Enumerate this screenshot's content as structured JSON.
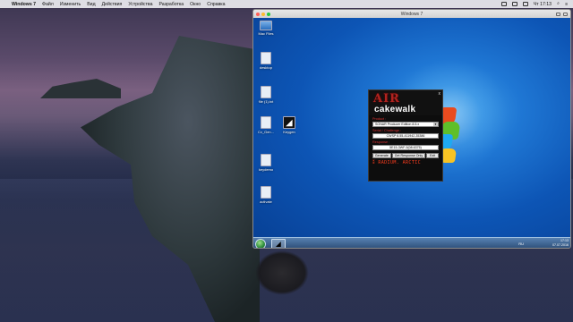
{
  "menubar": {
    "apple": "",
    "app_name": "Windows 7",
    "items": [
      "Файл",
      "Изменить",
      "Вид",
      "Действия",
      "Устройства",
      "Разработка",
      "Окно",
      "Справка"
    ],
    "clock": "Чт 17:13"
  },
  "vm": {
    "title": "Windows 7"
  },
  "desktop_icons": [
    {
      "label": "Mac Files",
      "kind": "pc"
    },
    {
      "label": "desktop",
      "kind": "file"
    },
    {
      "label": "file (1).txt",
      "kind": "file"
    },
    {
      "label": "Cv_Gen...",
      "kind": "file"
    },
    {
      "label": "Keygen",
      "kind": "app"
    },
    {
      "label": "keydemo",
      "kind": "file"
    },
    {
      "label": "activate",
      "kind": "file"
    }
  ],
  "keygen": {
    "logo": "AIR",
    "brand": "cakewalk",
    "close": "x",
    "product_label": "Product :",
    "product_value": "SONAR Producer Edition 8.5.x",
    "serial_label": "Serial / Challenge :",
    "serial_value": "CWSP 8.55-411942-35386",
    "response_label": "Response :",
    "response_value": "5E15-3WF-5(08.6375)",
    "buttons": [
      "Generate",
      "Get Response Only",
      "Exit"
    ],
    "footer": "RADIUM.  ARCTIC"
  },
  "taskbar": {
    "lang": "RU",
    "time": "17:13",
    "date": "07.07.2016"
  }
}
